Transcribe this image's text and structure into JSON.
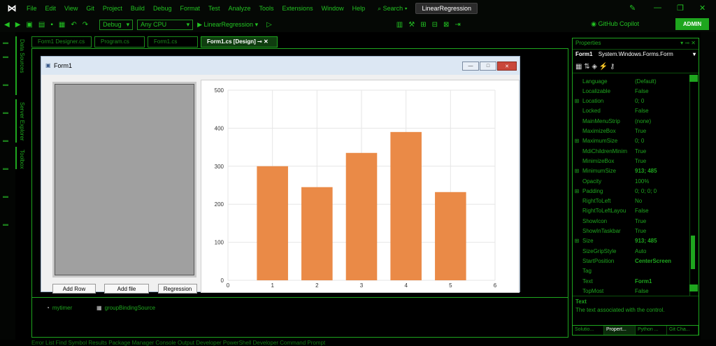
{
  "menu": {
    "logo": "⋈",
    "items": [
      "File",
      "Edit",
      "View",
      "Git",
      "Project",
      "Build",
      "Debug",
      "Format",
      "Test",
      "Analyze",
      "Tools",
      "Extensions",
      "Window",
      "Help"
    ],
    "search": "Search",
    "solution": "LinearRegression"
  },
  "toolbar": {
    "config": "Debug",
    "platform": "Any CPU",
    "run_label": "LinearRegression",
    "copilot": "GitHub Copilot",
    "admin": "ADMIN"
  },
  "rail": {
    "tabs": [
      "Data Sources",
      "Server Explorer",
      "Toolbox"
    ]
  },
  "tabs": [
    {
      "label": "Form1 Designer.cs"
    },
    {
      "label": "Program.cs"
    },
    {
      "label": "Form1.cs"
    },
    {
      "label": "Form1.cs [Design]",
      "active": true
    }
  ],
  "form": {
    "title": "Form1",
    "buttons": [
      "Add Row",
      "Add file",
      "Regression"
    ]
  },
  "chart_data": {
    "type": "bar",
    "title": "",
    "xlabel": "",
    "ylabel": "",
    "x": [
      1,
      2,
      3,
      4,
      5
    ],
    "values": [
      300,
      245,
      335,
      390,
      232
    ],
    "xlim": [
      0,
      6
    ],
    "ylim": [
      0,
      500
    ],
    "xticks": [
      0,
      1,
      2,
      3,
      4,
      5,
      6
    ],
    "yticks": [
      0,
      100,
      200,
      300,
      400,
      500
    ],
    "grid": true,
    "color": "#ea8a47"
  },
  "tray": {
    "items": [
      "mytimer",
      "groupBindingSource"
    ]
  },
  "status": "Error List  Find Symbol Results  Package Manager Console  Output  Developer PowerShell  Developer Command Prompt",
  "properties": {
    "header": "Properties",
    "object_name": "Form1",
    "object_type": "System.Windows.Forms.Form",
    "rows": [
      {
        "exp": "",
        "name": "Language",
        "value": "(Default)"
      },
      {
        "exp": "",
        "name": "Localizable",
        "value": "False"
      },
      {
        "exp": "⊞",
        "name": "Location",
        "value": "0; 0"
      },
      {
        "exp": "",
        "name": "Locked",
        "value": "False"
      },
      {
        "exp": "",
        "name": "MainMenuStrip",
        "value": "(none)"
      },
      {
        "exp": "",
        "name": "MaximizeBox",
        "value": "True"
      },
      {
        "exp": "⊞",
        "name": "MaximumSize",
        "value": "0; 0"
      },
      {
        "exp": "",
        "name": "MdiChildrenMinim",
        "value": "True"
      },
      {
        "exp": "",
        "name": "MinimizeBox",
        "value": "True"
      },
      {
        "exp": "⊞",
        "name": "MinimumSize",
        "value": "913; 485",
        "bold": true
      },
      {
        "exp": "",
        "name": "Opacity",
        "value": "100%"
      },
      {
        "exp": "⊞",
        "name": "Padding",
        "value": "0; 0; 0; 0"
      },
      {
        "exp": "",
        "name": "RightToLeft",
        "value": "No"
      },
      {
        "exp": "",
        "name": "RightToLeftLayou",
        "value": "False"
      },
      {
        "exp": "",
        "name": "ShowIcon",
        "value": "True"
      },
      {
        "exp": "",
        "name": "ShowInTaskbar",
        "value": "True"
      },
      {
        "exp": "⊞",
        "name": "Size",
        "value": "913; 485",
        "bold": true
      },
      {
        "exp": "",
        "name": "SizeGripStyle",
        "value": "Auto"
      },
      {
        "exp": "",
        "name": "StartPosition",
        "value": "CenterScreen",
        "bold": true
      },
      {
        "exp": "",
        "name": "Tag",
        "value": ""
      },
      {
        "exp": "",
        "name": "Text",
        "value": "Form1",
        "bold": true
      },
      {
        "exp": "",
        "name": "TopMost",
        "value": "False"
      }
    ],
    "desc_title": "Text",
    "desc_text": "The text associated with the control.",
    "tabs": [
      "Solutio...",
      "Propert...",
      "Python ...",
      "Git Cha..."
    ]
  },
  "colors": {
    "accent": "#1ea61e",
    "bar": "#ea8a47",
    "background": "#000000"
  }
}
